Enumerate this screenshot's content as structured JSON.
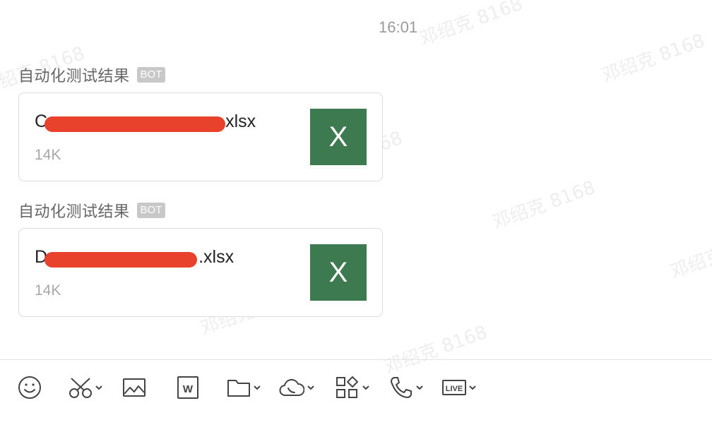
{
  "watermark": {
    "text": "邓绍克 8168"
  },
  "chat": {
    "timestamp": "16:01",
    "messages": [
      {
        "sender": "自动化测试结果",
        "badge": "BOT",
        "file": {
          "name_prefix": "C",
          "name_suffix": "xlsx",
          "size": "14K",
          "icon_letter": "X"
        }
      },
      {
        "sender": "自动化测试结果",
        "badge": "BOT",
        "file": {
          "name_prefix": "D",
          "name_suffix": ".xlsx",
          "size": "14K",
          "icon_letter": "X"
        }
      }
    ]
  },
  "toolbar": {
    "tools": [
      {
        "icon": "emoji-icon",
        "has_dropdown": false
      },
      {
        "icon": "scissors-icon",
        "has_dropdown": true
      },
      {
        "icon": "image-icon",
        "has_dropdown": false
      },
      {
        "icon": "word-doc-icon",
        "has_dropdown": false
      },
      {
        "icon": "folder-icon",
        "has_dropdown": true
      },
      {
        "icon": "cloud-icon",
        "has_dropdown": true
      },
      {
        "icon": "apps-icon",
        "has_dropdown": true
      },
      {
        "icon": "phone-icon",
        "has_dropdown": true
      },
      {
        "icon": "live-icon",
        "has_dropdown": true
      }
    ]
  },
  "colors": {
    "excel_green": "#3e7a4f",
    "redaction_red": "#e8412c",
    "badge_gray": "#c8c8c8"
  }
}
